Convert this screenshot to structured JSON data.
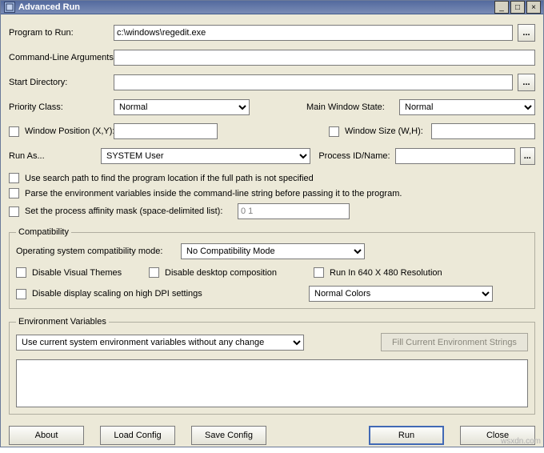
{
  "window": {
    "title": "Advanced Run",
    "minimize": "_",
    "maximize": "□",
    "close": "×"
  },
  "labels": {
    "program_to_run": "Program to Run:",
    "cmdline_args": "Command-Line Arguments:",
    "start_directory": "Start Directory:",
    "priority_class": "Priority Class:",
    "main_window_state": "Main Window State:",
    "window_position": "Window Position (X,Y):",
    "window_size": "Window Size (W,H):",
    "run_as": "Run As...",
    "process_id_name": "Process ID/Name:",
    "use_search_path": "Use search path to find the program location if the full path is not specified",
    "parse_env": "Parse the environment variables inside the command-line string before passing it to the program.",
    "set_affinity": "Set the process affinity mask (space-delimited list):",
    "compatibility": "Compatibility",
    "os_compat_mode": "Operating system compatibility mode:",
    "disable_visual_themes": "Disable Visual Themes",
    "disable_desktop_comp": "Disable desktop composition",
    "run_640": "Run In 640 X 480 Resolution",
    "disable_dpi_scaling": "Disable display scaling on high DPI settings",
    "env_variables": "Environment Variables",
    "fill_env": "Fill Current Environment Strings"
  },
  "values": {
    "program": "c:\\windows\\regedit.exe",
    "cmdline": "",
    "start_dir": "",
    "priority": "Normal",
    "window_state": "Normal",
    "win_pos": "",
    "win_size": "",
    "run_as": "SYSTEM User",
    "process_id": "",
    "affinity": "0 1",
    "compat_mode": "No Compatibility Mode",
    "colors_mode": "Normal Colors",
    "env_var_mode": "Use current system environment variables without any change",
    "env_text": ""
  },
  "buttons": {
    "browse": "...",
    "about": "About",
    "load_config": "Load Config",
    "save_config": "Save Config",
    "run": "Run",
    "close": "Close"
  },
  "watermark": "wsxdn.com"
}
